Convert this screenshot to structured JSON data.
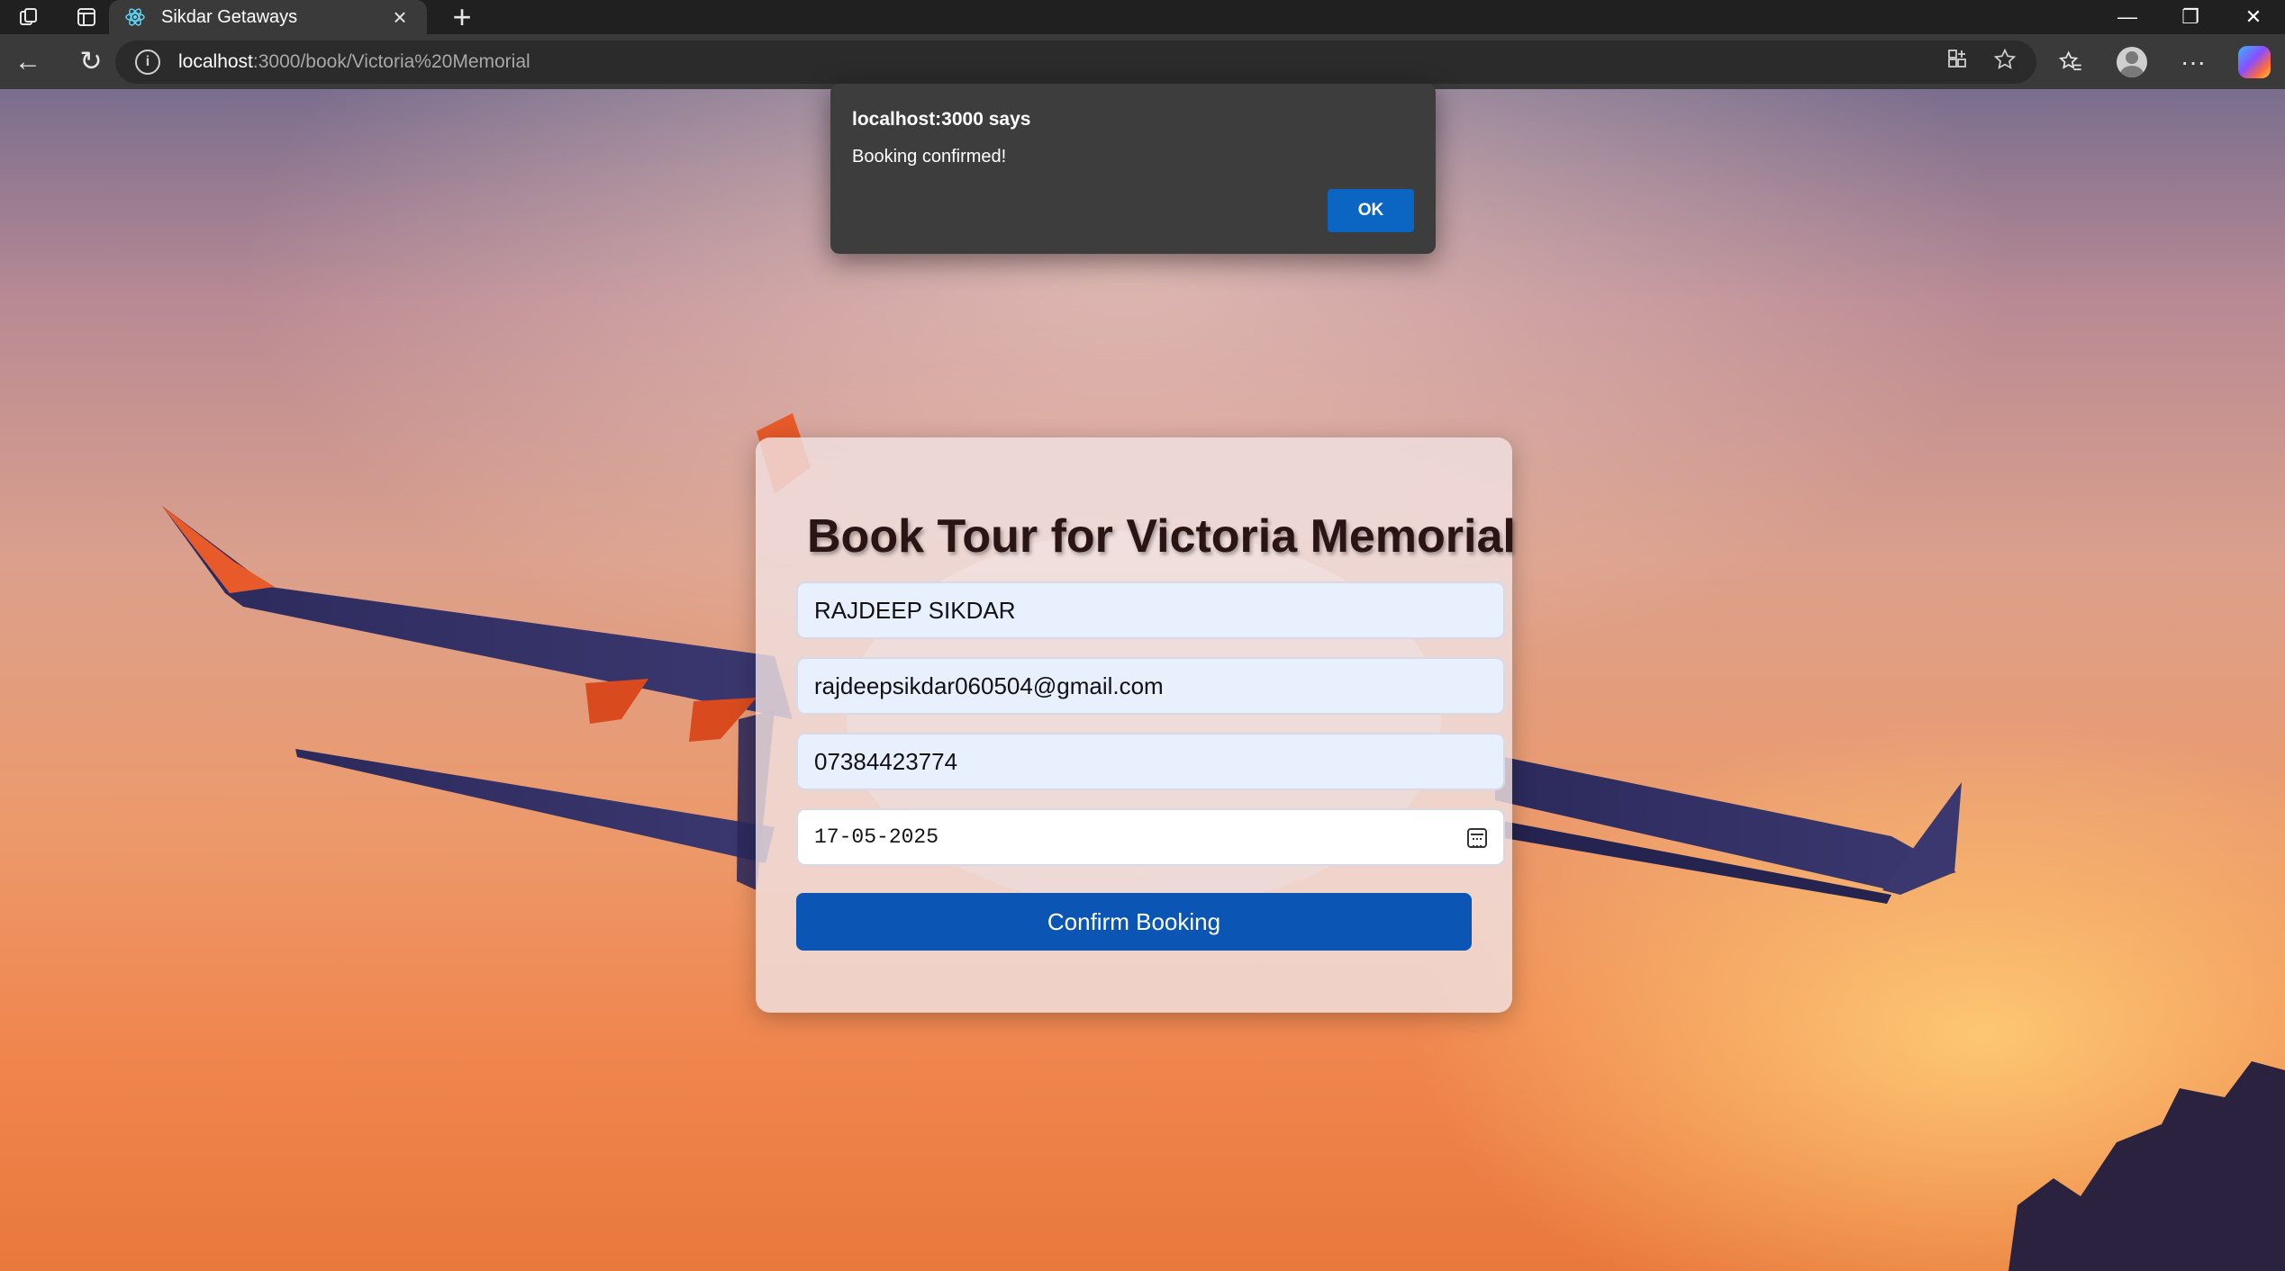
{
  "browser": {
    "tab": {
      "title": "Sikdar Getaways",
      "favicon": "react-icon"
    },
    "address": {
      "host": "localhost",
      "rest": ":3000/book/Victoria%20Memorial"
    },
    "icons": {
      "workspaces": "workspaces-icon",
      "tab_actions": "tab-actions-icon",
      "close_tab": "×",
      "new_tab": "+",
      "back": "←",
      "refresh": "↻",
      "minimize": "—",
      "restore": "❐",
      "close": "✕",
      "more": "···"
    }
  },
  "dialog": {
    "title": "localhost:3000 says",
    "message": "Booking confirmed!",
    "ok_label": "OK"
  },
  "booking": {
    "heading": "Book Tour for Victoria Memorial",
    "name": "RAJDEEP SIKDAR",
    "email": "rajdeepsikdar060504@gmail.com",
    "phone": "07384423774",
    "date": "17-05-2025",
    "button": "Confirm Booking"
  },
  "colors": {
    "button": "#0b56b4",
    "dialog_ok": "#0b66c3",
    "dialog_bg": "#3d3d3d"
  }
}
